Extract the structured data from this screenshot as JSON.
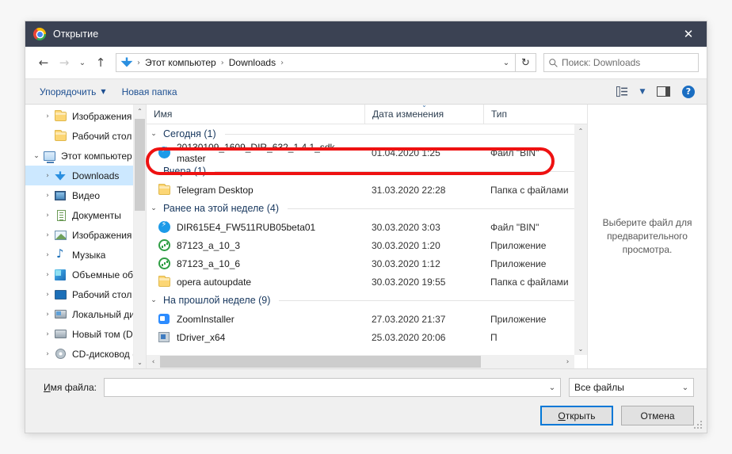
{
  "window": {
    "title": "Открытие",
    "app_icon": "chrome-icon",
    "close_label": "✕"
  },
  "nav": {
    "back": "←",
    "forward": "→",
    "recent": "⌄",
    "up": "↑",
    "address_icon": "downloads-arrow-icon",
    "breadcrumbs": [
      "Этот компьютер",
      "Downloads"
    ],
    "separator": "›",
    "dropdown_caret": "⌄",
    "refresh": "↻",
    "search_placeholder": "Поиск: Downloads",
    "search_value": ""
  },
  "toolbar": {
    "organize_label": "Упорядочить",
    "organize_caret": "▼",
    "new_folder_label": "Новая папка",
    "view_icon": "view-options-icon",
    "view_caret": "▼",
    "preview_pane_icon": "preview-pane-icon",
    "help_icon": "help-icon",
    "help_glyph": "?"
  },
  "sidebar": {
    "items": [
      {
        "label": "Изображения",
        "icon": "folder-icon",
        "chevron": "›",
        "indent": 1,
        "selected": false
      },
      {
        "label": "Рабочий стол",
        "icon": "folder-icon",
        "chevron": "",
        "indent": 1,
        "selected": false
      },
      {
        "label": "Этот компьютер",
        "icon": "computer-icon",
        "chevron": "⌄",
        "indent": 0,
        "selected": false
      },
      {
        "label": "Downloads",
        "icon": "downloads-arrow-icon",
        "chevron": "›",
        "indent": 1,
        "selected": true
      },
      {
        "label": "Видео",
        "icon": "video-icon",
        "chevron": "›",
        "indent": 1,
        "selected": false
      },
      {
        "label": "Документы",
        "icon": "documents-icon",
        "chevron": "›",
        "indent": 1,
        "selected": false
      },
      {
        "label": "Изображения",
        "icon": "pictures-icon",
        "chevron": "›",
        "indent": 1,
        "selected": false
      },
      {
        "label": "Музыка",
        "icon": "music-icon",
        "chevron": "›",
        "indent": 1,
        "selected": false
      },
      {
        "label": "Объемные объ",
        "icon": "3d-objects-icon",
        "chevron": "›",
        "indent": 1,
        "selected": false
      },
      {
        "label": "Рабочий стол",
        "icon": "desktop-icon",
        "chevron": "›",
        "indent": 1,
        "selected": false
      },
      {
        "label": "Локальный дис",
        "icon": "local-disk-icon",
        "chevron": "›",
        "indent": 1,
        "selected": false
      },
      {
        "label": "Новый том (D:)",
        "icon": "drive-icon",
        "chevron": "›",
        "indent": 1,
        "selected": false
      },
      {
        "label": "CD-дисковод (F",
        "icon": "cd-drive-icon",
        "chevron": "›",
        "indent": 1,
        "selected": false
      }
    ],
    "scroll_up": "⌃",
    "scroll_down": "⌄"
  },
  "filelist": {
    "columns": [
      "Имя",
      "Дата изменения",
      "Тип"
    ],
    "sort_column": "Дата изменения",
    "sort_mark": "⌄",
    "groups": [
      {
        "label": "Сегодня (1)",
        "chevron": "⌄",
        "rows": [
          {
            "name": "20130109_1609_DIR_632_1.4.1_sdk-master",
            "date": "01.04.2020 1:25",
            "type": "Файл \"BIN\"",
            "icon": "bin-file-icon",
            "highlighted": true
          }
        ]
      },
      {
        "label": "Вчера (1)",
        "chevron": "⌄",
        "rows": [
          {
            "name": "Telegram Desktop",
            "date": "31.03.2020 22:28",
            "type": "Папка с файлами",
            "icon": "folder-icon",
            "highlighted": false
          }
        ]
      },
      {
        "label": "Ранее на этой неделе (4)",
        "chevron": "⌄",
        "rows": [
          {
            "name": "DIR615E4_FW511RUB05beta01",
            "date": "30.03.2020 3:03",
            "type": "Файл \"BIN\"",
            "icon": "bin-file-icon",
            "highlighted": false
          },
          {
            "name": "87123_a_10_3",
            "date": "30.03.2020 1:20",
            "type": "Приложение",
            "icon": "application-icon",
            "highlighted": false
          },
          {
            "name": "87123_a_10_6",
            "date": "30.03.2020 1:12",
            "type": "Приложение",
            "icon": "application-icon",
            "highlighted": false
          },
          {
            "name": "opera autoupdate",
            "date": "30.03.2020 19:55",
            "type": "Папка с файлами",
            "icon": "folder-icon",
            "highlighted": false
          }
        ]
      },
      {
        "label": "На прошлой неделе (9)",
        "chevron": "⌄",
        "rows": [
          {
            "name": "ZoomInstaller",
            "date": "27.03.2020 21:37",
            "type": "Приложение",
            "icon": "zoom-icon",
            "highlighted": false
          },
          {
            "name": "tDriver_x64",
            "date": "25.03.2020 20:06",
            "type": "П",
            "icon": "cut-icon",
            "highlighted": false
          }
        ]
      }
    ],
    "hscroll_left": "‹",
    "hscroll_right": "›",
    "vscroll_up": "⌃",
    "vscroll_down": "⌄"
  },
  "preview": {
    "text": "Выберите файл для предварительного просмотра."
  },
  "footer": {
    "filename_label_prefix": "И",
    "filename_label_rest": "мя файла:",
    "filename_value": "",
    "filename_caret": "⌄",
    "filetype_value": "Все файлы",
    "filetype_caret": "⌄",
    "open_prefix": "О",
    "open_rest": "ткрыть",
    "cancel_label": "Отмена"
  },
  "annotation": {
    "color": "#ee1111",
    "shape": "rounded-rect-highlight"
  }
}
